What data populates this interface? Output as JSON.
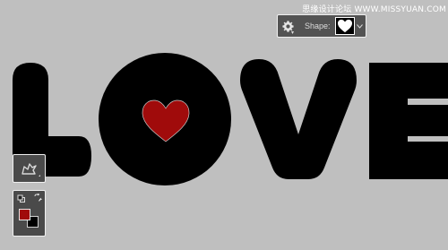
{
  "watermark": "思缘设计论坛 WWW.MISSYUAN.COM",
  "canvas": {
    "word": "LOVE",
    "background_color": "#bfbfbf",
    "text_color": "#000000",
    "heart_color": "#a00b0b"
  },
  "options_bar": {
    "gear_icon": "gear-icon",
    "shape_label": "Shape:",
    "selected_shape": "heart"
  },
  "tools": {
    "custom_shape_icon": "custom-shape-tool-icon",
    "foreground_color": "#a00b0b",
    "background_color": "#000000"
  }
}
